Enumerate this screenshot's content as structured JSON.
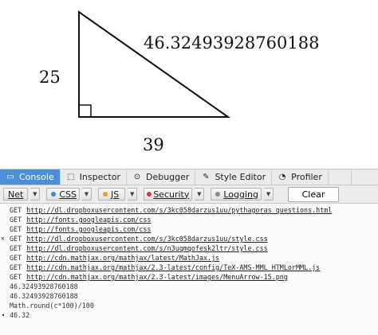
{
  "figure": {
    "side_left": "25",
    "side_bottom": "39",
    "hypotenuse": "46.32493928760188"
  },
  "tabs": [
    {
      "label": "Console",
      "icon": "console-icon",
      "glyph": "▭",
      "active": true
    },
    {
      "label": "Inspector",
      "icon": "inspector-icon",
      "glyph": "⬚",
      "active": false
    },
    {
      "label": "Debugger",
      "icon": "debugger-icon",
      "glyph": "⊙",
      "active": false
    },
    {
      "label": "Style Editor",
      "icon": "style-editor-icon",
      "glyph": "✎",
      "active": false
    },
    {
      "label": "Profiler",
      "icon": "profiler-icon",
      "glyph": "◔",
      "active": false
    }
  ],
  "filters": {
    "net": {
      "label": "Net"
    },
    "css": {
      "label": "CSS",
      "color": "#3b8ed8"
    },
    "js": {
      "label": "JS",
      "color": "#e8a02d"
    },
    "security": {
      "label": "Security",
      "color": "#d93838"
    },
    "logging": {
      "label": "Logging",
      "color": "#8a8a8a"
    },
    "clear": "Clear"
  },
  "log": [
    {
      "type": "request",
      "method": "GET",
      "url": "http://dl.dropboxusercontent.com/s/3kc058darzus1uu/pythagoras_questions.html"
    },
    {
      "type": "request",
      "method": "GET",
      "url": "http://fonts.googleapis.com/css"
    },
    {
      "type": "request",
      "method": "GET",
      "url": "http://fonts.googleapis.com/css"
    },
    {
      "type": "request",
      "method": "GET",
      "url": "http://dl.dropboxusercontent.com/s/3kc058darzus1uu/style.css",
      "marker": "✕"
    },
    {
      "type": "request",
      "method": "GET",
      "url": "http://dl.dropboxusercontent.com/s/n3uqmqofesk2ltr/style.css"
    },
    {
      "type": "request",
      "method": "GET",
      "url": "http://cdn.mathjax.org/mathjax/latest/MathJax.js"
    },
    {
      "type": "request",
      "method": "GET",
      "url": "http://cdn.mathjax.org/mathjax/2.3-latest/config/TeX-AMS-MML_HTMLorMML.js"
    },
    {
      "type": "request",
      "method": "GET",
      "url": "http://cdn.mathjax.org/mathjax/2.3-latest/images/MenuArrow-15.png"
    },
    {
      "type": "output",
      "text": "46.32493928760188"
    },
    {
      "type": "output",
      "text": "46.32493928760188"
    },
    {
      "type": "input",
      "text": "Math.round(c*100)/100"
    },
    {
      "type": "output",
      "text": "46.32",
      "marker": "◂"
    }
  ]
}
